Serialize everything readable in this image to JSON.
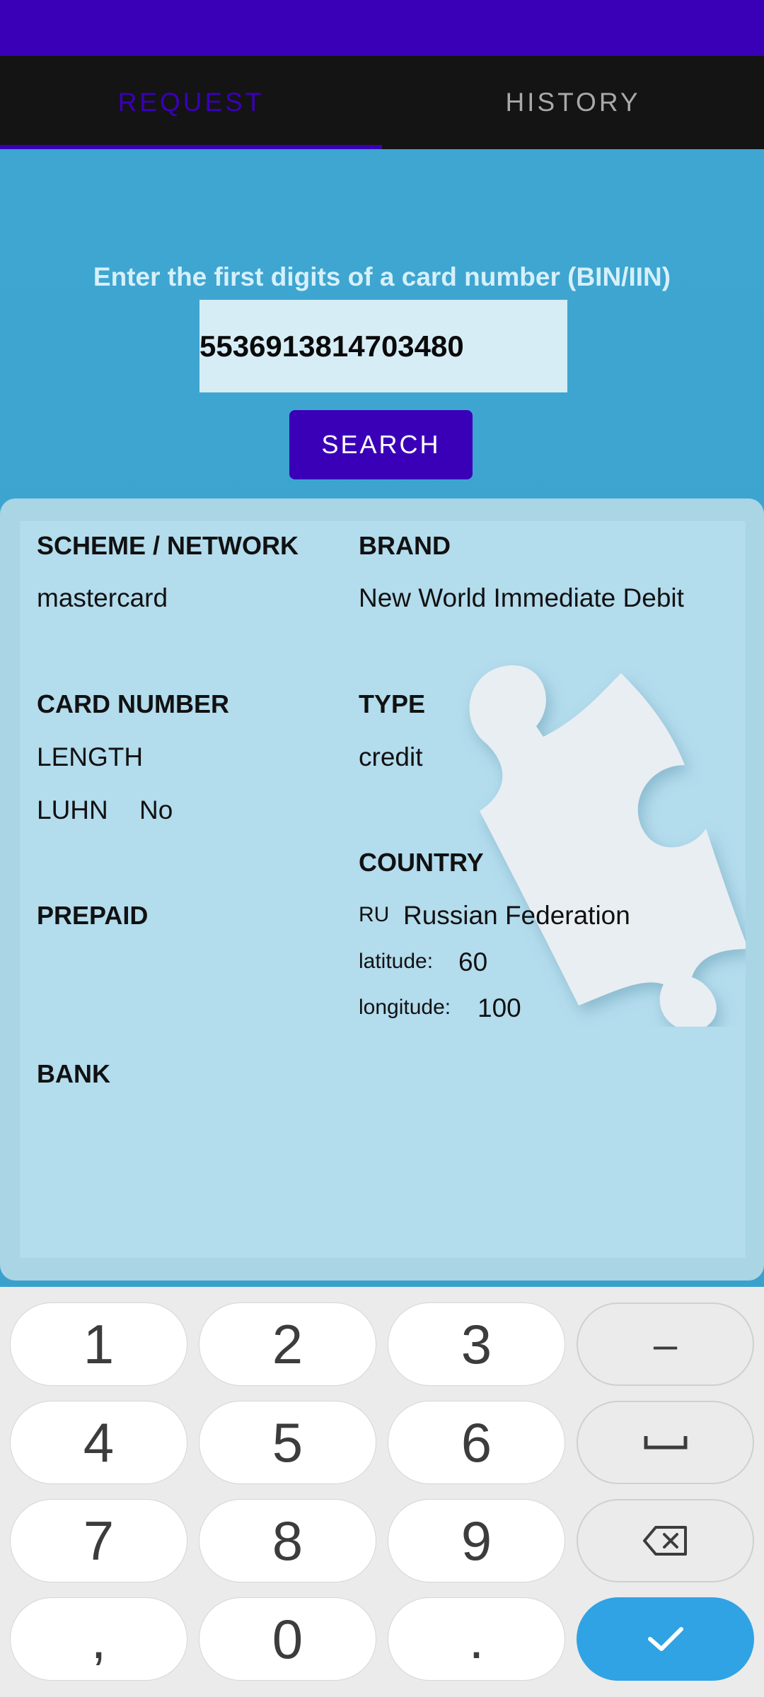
{
  "tabs": {
    "request": "REQUEST",
    "history": "HISTORY"
  },
  "search": {
    "prompt": "Enter the first digits of a card number (BIN/IIN)",
    "input_value": "5536913814703480",
    "button_label": "SEARCH"
  },
  "result": {
    "scheme_label": "SCHEME / NETWORK",
    "scheme_value": "mastercard",
    "brand_label": "BRAND",
    "brand_value": "New World Immediate Debit",
    "card_number_label": "CARD NUMBER",
    "length_label": "LENGTH",
    "luhn_label": "LUHN",
    "luhn_value": "No",
    "type_label": "TYPE",
    "type_value": "credit",
    "country_label": "COUNTRY",
    "country_code": "RU",
    "country_name": "Russian Federation",
    "latitude_label": "latitude:",
    "latitude_value": "60",
    "longitude_label": "longitude:",
    "longitude_value": "100",
    "prepaid_label": "PREPAID",
    "bank_label": "BANK"
  },
  "keyboard": {
    "row1": [
      "1",
      "2",
      "3",
      "–"
    ],
    "row2": [
      "4",
      "5",
      "6"
    ],
    "row3": [
      "7",
      "8",
      "9"
    ],
    "row4": [
      ",",
      "0",
      "."
    ]
  },
  "colors": {
    "accent": "#3a00b8",
    "background": "#3aa3cf",
    "enter_key": "#2fa3e3"
  }
}
